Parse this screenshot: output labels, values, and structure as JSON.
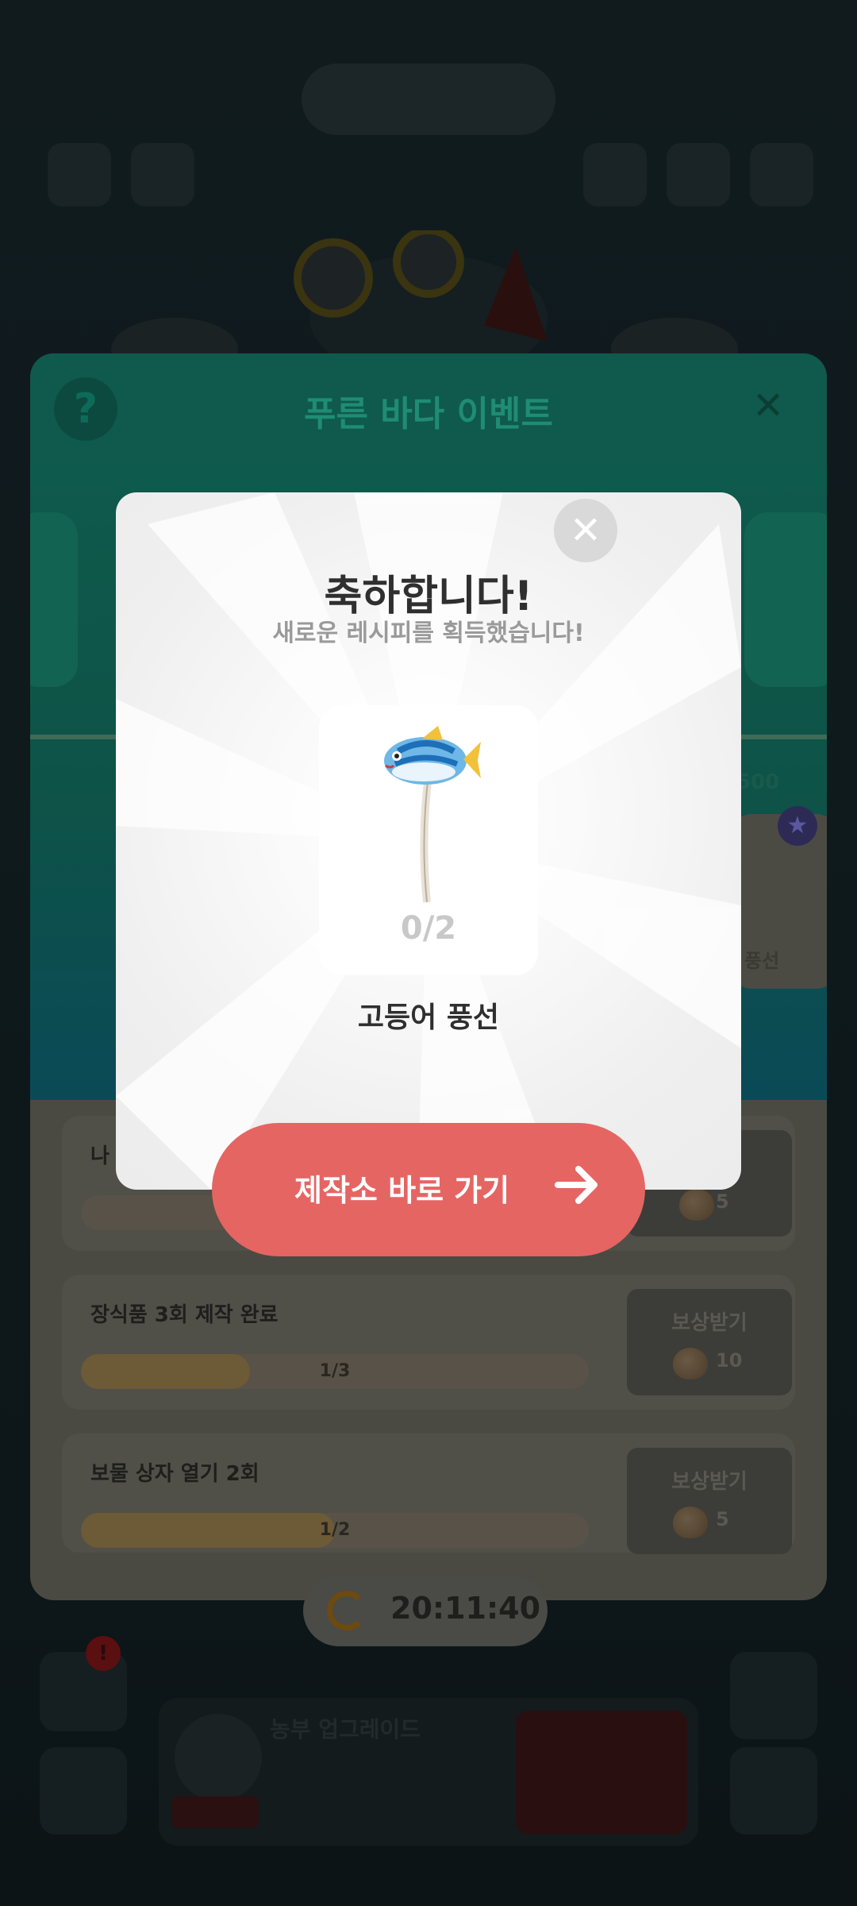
{
  "background": {
    "event_title": "푸른 바다 이벤트",
    "help_symbol": "?",
    "close_symbol": "✕",
    "card_label": "풍선",
    "quest_partial_label": "나",
    "quests": [
      {
        "label": "",
        "progress_text": "",
        "reward_label": "",
        "reward_qty": "5",
        "progress": 0.0
      },
      {
        "label": "장식품 3회 제작 완료",
        "progress_text": "1/3",
        "reward_label": "보상받기",
        "reward_qty": "10",
        "progress": 0.333
      },
      {
        "label": "보물 상자 열기 2회",
        "progress_text": "1/2",
        "reward_label": "보상받기",
        "reward_qty": "5",
        "progress": 0.5
      }
    ],
    "timer": "20:11:40",
    "upgrade_title": "농부 업그레이드"
  },
  "modal": {
    "title": "축하합니다!",
    "subtitle": "새로운 레시피를 획득했습니다!",
    "recipe_name": "고등어 풍선",
    "recipe_count": "0/2",
    "recipe_icon": "mackerel-balloon-icon",
    "close_icon": "close-icon",
    "close_symbol": "✕",
    "go_button_label": "제작소 바로 가기",
    "go_button_icon": "arrow-right-icon"
  },
  "colors": {
    "primary_button": "#e56563",
    "event_teal": "#0e5a4c",
    "modal_bg": "#f2f2f2"
  }
}
